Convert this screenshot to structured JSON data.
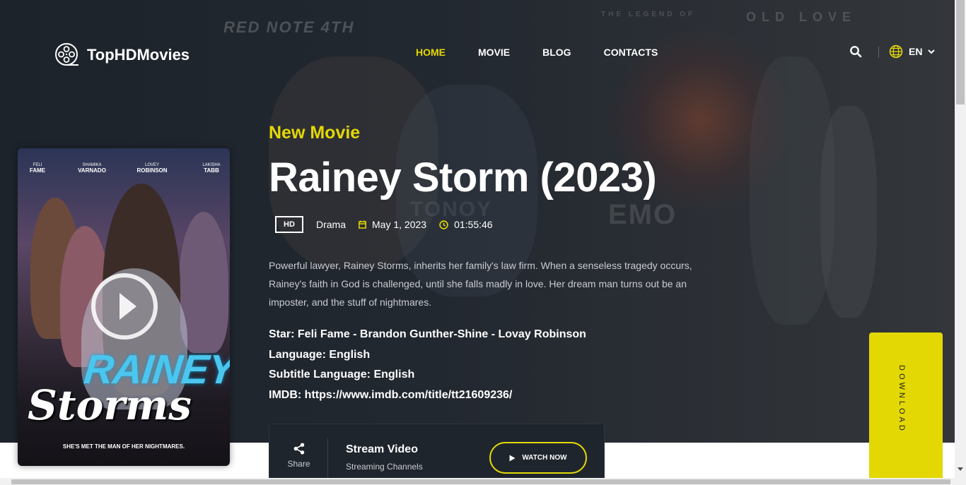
{
  "brand": {
    "name": "TopHDMovies"
  },
  "nav": {
    "items": [
      {
        "label": "HOME",
        "active": true
      },
      {
        "label": "MOVIE",
        "active": false
      },
      {
        "label": "BLOG",
        "active": false
      },
      {
        "label": "CONTACTS",
        "active": false
      }
    ]
  },
  "header": {
    "search_icon": "search-icon",
    "language": "EN",
    "language_icon": "globe-icon"
  },
  "background_text": {
    "left": "RED NOTE 4TH",
    "center": "THE LEGEND OF",
    "right": "OLD LOVE",
    "center2": "TONOY",
    "emo": "EMO"
  },
  "poster": {
    "cast": [
      {
        "first": "FELI",
        "last": "FAME"
      },
      {
        "first": "SHAMIKA",
        "last": "VARNADO"
      },
      {
        "first": "LOVEY",
        "last": "ROBINSON"
      },
      {
        "first": "LAKISHA",
        "last": "TABB"
      }
    ],
    "title_line1": "RAINEY",
    "title_line2": "Storms",
    "tagline": "SHE'S MET THE MAN OF HER NIGHTMARES."
  },
  "movie": {
    "subtitle": "New Movie",
    "title": "Rainey Storm (2023)",
    "quality": "HD",
    "genre": "Drama",
    "release_date": "May 1, 2023",
    "duration": "01:55:46",
    "description": "Powerful lawyer, Rainey Storms, inherits her family's law firm. When a senseless tragedy occurs, Rainey's faith in God is challenged, until she falls madly in love. Her dream man turns out be an imposter, and the stuff of nightmares.",
    "star_label": "Star:",
    "stars": "Feli Fame - Brandon Gunther-Shine - Lovay Robinson",
    "language_label": "Language:",
    "language": "English",
    "subtitle_language_label": "Subtitle Language:",
    "subtitle_language": "English",
    "imdb_label": "IMDB:",
    "imdb_url": "https://www.imdb.com/title/tt21609236/"
  },
  "stream": {
    "share_label": "Share",
    "title": "Stream Video",
    "subtitle": "Streaming Channels",
    "watch_label": "WATCH NOW"
  },
  "download": {
    "label": "DOWNLOAD"
  },
  "colors": {
    "accent": "#e4d804",
    "background": "#1d232b",
    "panel": "#1f252d"
  }
}
